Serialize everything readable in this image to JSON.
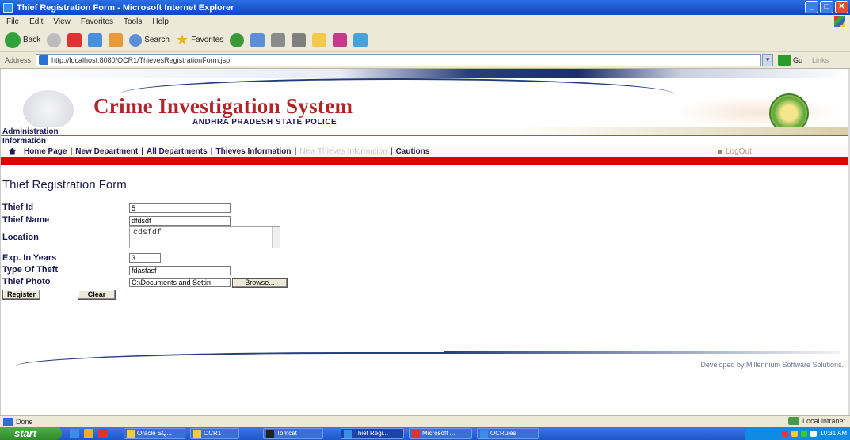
{
  "window": {
    "title": "Thief Registration Form - Microsoft Internet Explorer",
    "minimize": "_",
    "maximize": "□",
    "close": "✕"
  },
  "menu": [
    "File",
    "Edit",
    "View",
    "Favorites",
    "Tools",
    "Help"
  ],
  "toolbar": {
    "back": "Back",
    "search": "Search",
    "favorites": "Favorites"
  },
  "address": {
    "label": "Address",
    "url": "http://localhost:8080/OCR1/ThievesRegistrationForm.jsp",
    "go": "Go",
    "links": "Links"
  },
  "header": {
    "title": "Crime Investigation System",
    "subtitle": "ANDHRA PRADESH STATE POLICE"
  },
  "nav": {
    "admin": "Administration",
    "info": "Information",
    "items": [
      "Home Page",
      "New Department",
      "All Departments",
      "Thieves Information",
      "New Thieves Information",
      "Cautions"
    ],
    "logout": "LogOut"
  },
  "form": {
    "heading": "Thief Registration Form",
    "fields": {
      "thief_id": {
        "label": "Thief Id",
        "value": "5"
      },
      "thief_name": {
        "label": "Thief Name",
        "value": "dfdsdf"
      },
      "location": {
        "label": "Location",
        "value": "cdsfdf"
      },
      "exp_years": {
        "label": "Exp. In Years",
        "value": "3"
      },
      "theft_type": {
        "label": "Type Of Theft",
        "value": "fdasfasf"
      },
      "photo": {
        "label": "Thief Photo",
        "value": "C:\\Documents and Settin",
        "browse": "Browse..."
      }
    },
    "register": "Register",
    "clear": "Clear"
  },
  "footer": {
    "credit": "Developed by:Millennium Software Solutions."
  },
  "status": {
    "text": "Done",
    "zone": "Local intranet"
  },
  "taskbar": {
    "start": "start",
    "tasks": [
      "Oracle SQ...",
      "OCR1",
      "Tomcat",
      "Thief Regi...",
      "Microsoft ...",
      "OCRules"
    ],
    "clock": "10:31 AM"
  },
  "colors": {
    "title_red": "#b0242a",
    "nav_navy": "#1a1a5e",
    "red_bar": "#e00000"
  }
}
